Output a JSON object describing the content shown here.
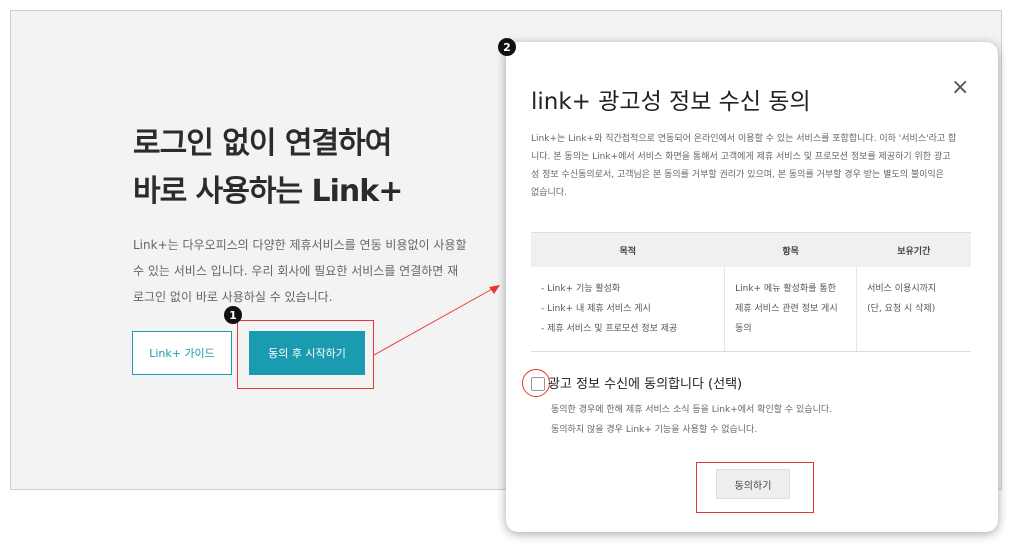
{
  "hero": {
    "title_line1": "로그인 없이 연결하여",
    "title_line2": "바로 사용하는 Link+",
    "desc_line1": "Link+는 다우오피스의 다양한 제휴서비스를 연동 비용없이 사용할",
    "desc_line2": "수 있는 서비스 입니다. 우리 회사에 필요한 서비스를 연결하면 재",
    "desc_line3": "로그인 없이 바로 사용하실 수 있습니다.",
    "guide_button": "Link+ 가이드",
    "start_button": "동의 후 시작하기"
  },
  "badges": {
    "step1": "1",
    "step2": "2"
  },
  "modal": {
    "title": "link+ 광고성 정보 수신 동의",
    "close": "×",
    "intro_line1": "Link+는 Link+와 직간접적으로 연동되어 온라인에서 이용할 수 있는 서비스를 포함합니다. 이하 '서비스'라고 합",
    "intro_line2": "니다. 본 동의는 Link+에서 서비스 화면을 통해서 고객에게 제휴 서비스 및 프로모션 정보를 제공하기 위한 광고",
    "intro_line3": "성 정보 수신동의로서, 고객님은 본 동의를 거부할 권리가 있으며, 본 동의를 거부할 경우 받는 별도의 불이익은",
    "intro_line4": "없습니다.",
    "table": {
      "headers": [
        "목적",
        "항목",
        "보유기간"
      ],
      "purpose": [
        "- Link+ 기능 활성화",
        "- Link+ 내 제휴 서비스 게시",
        "- 제휴 서비스 및 프로모션 정보 제공"
      ],
      "items": [
        "Link+ 메뉴 활성화를 통한",
        "제휴 서비스 관련 정보 게시 동의"
      ],
      "retention": [
        "서비스 이용시까지",
        "(단, 요청 시 삭제)"
      ]
    },
    "checkbox_label": "광고 정보 수신에 동의합니다 (선택)",
    "note1": "동의한 경우에 한해 제휴 서비스 소식 등을 Link+에서 확인할 수 있습니다.",
    "note2": "동의하지 않을 경우 Link+ 기능을 사용할 수 없습니다.",
    "agree_button": "동의하기"
  },
  "colors": {
    "accent": "#1a9bb0",
    "highlight": "#e53935"
  }
}
